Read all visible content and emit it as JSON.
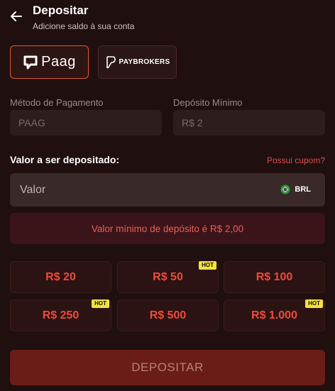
{
  "header": {
    "title": "Depositar",
    "subtitle": "Adicione saldo à sua conta"
  },
  "providers": [
    {
      "name": "Paag",
      "selected": true
    },
    {
      "name": "PAYBROKERS",
      "selected": false
    }
  ],
  "payment_method": {
    "label": "Método de Pagamento",
    "value": "PAAG"
  },
  "min_deposit": {
    "label": "Depósito Mínimo",
    "value": "R$ 2"
  },
  "amount": {
    "label": "Valor a ser depositado:",
    "coupon": "Possui cupom?",
    "placeholder": "Valor",
    "currency": "BRL"
  },
  "min_message": "Valor mínimo de depósito é R$ 2,00",
  "quick_amounts": [
    {
      "label": "R$ 20",
      "hot": false
    },
    {
      "label": "R$ 50",
      "hot": true
    },
    {
      "label": "R$ 100",
      "hot": false
    },
    {
      "label": "R$ 250",
      "hot": true
    },
    {
      "label": "R$ 500",
      "hot": false
    },
    {
      "label": "R$ 1.000",
      "hot": true
    }
  ],
  "hot_label": "HOT",
  "submit_label": "DEPOSITAR",
  "colors": {
    "background": "#1f0f0f",
    "accent": "#f04a3a",
    "hot_badge": "#f4e23a",
    "error_text": "#ef5a5a"
  }
}
